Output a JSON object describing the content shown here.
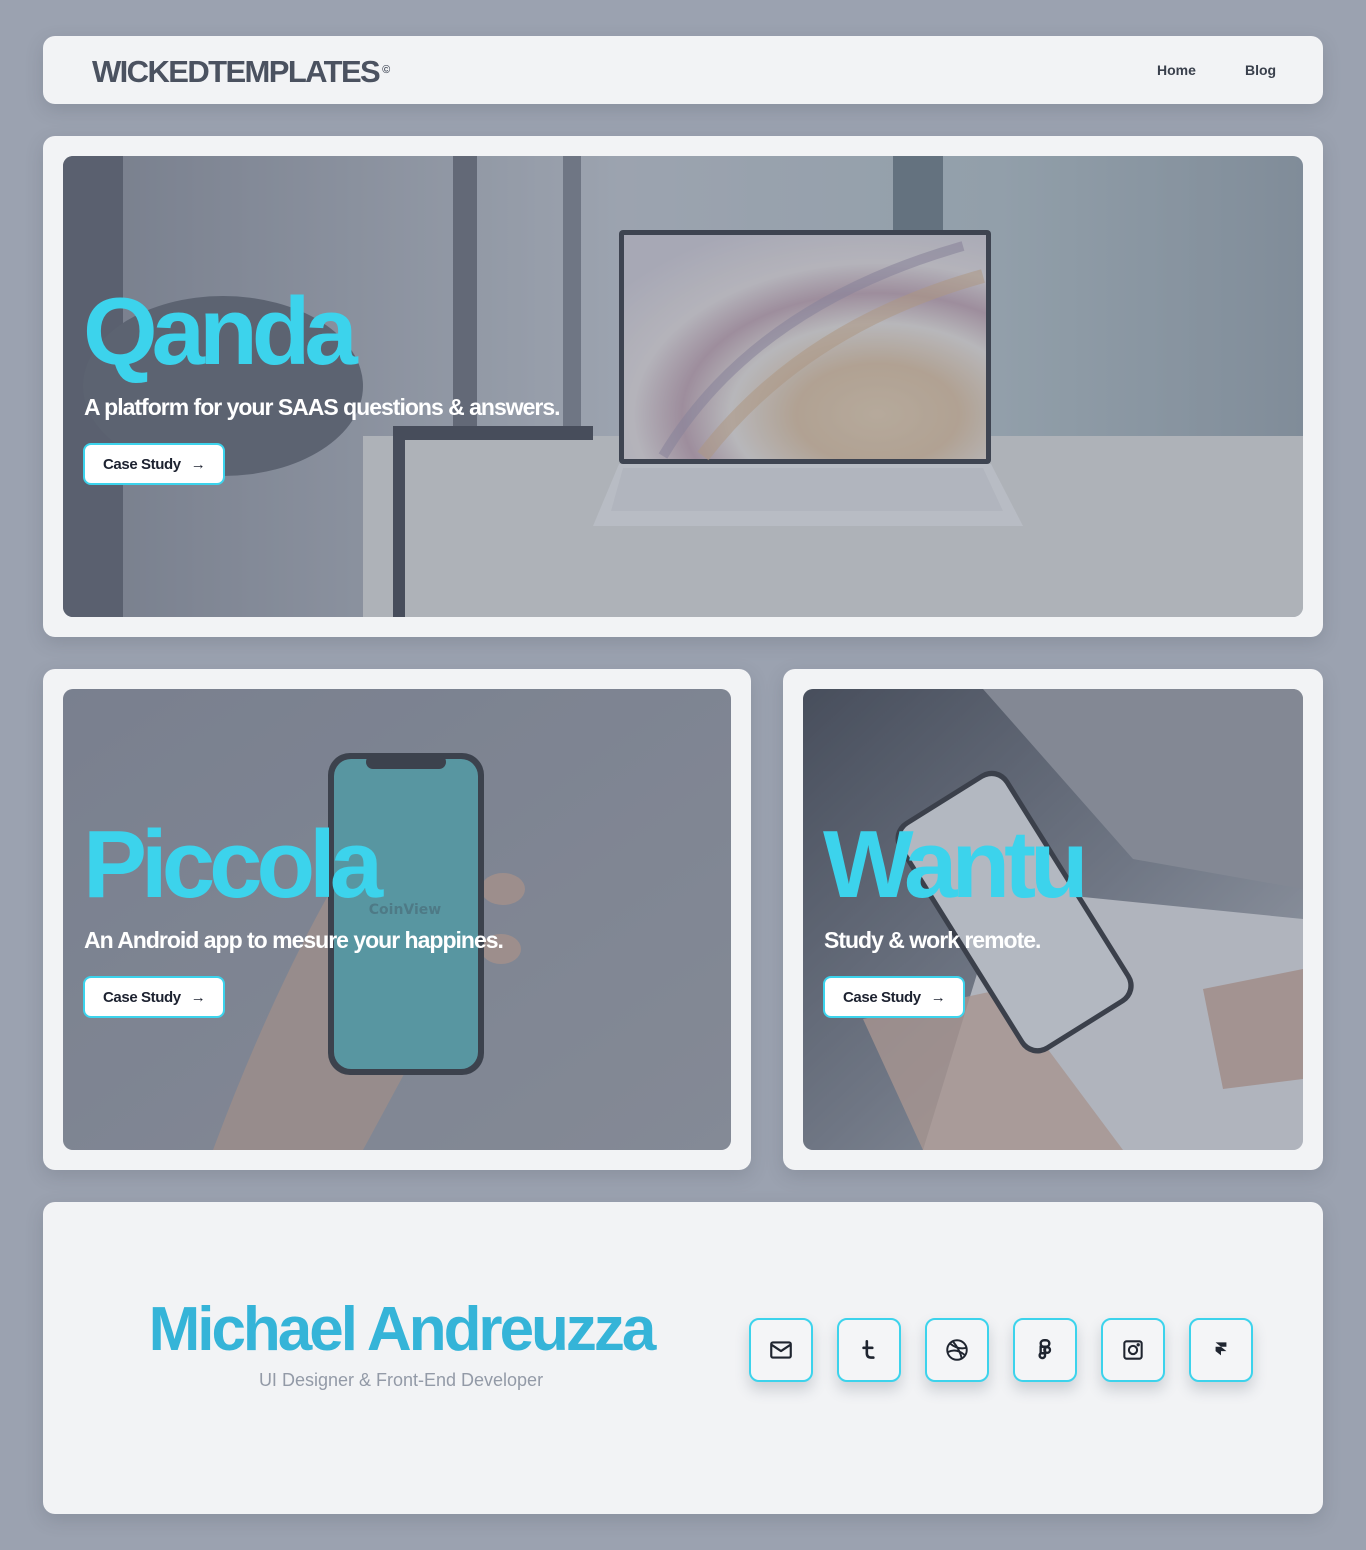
{
  "header": {
    "logo_text": "WICKEDTEMPLATES",
    "logo_mark": "©",
    "nav": [
      {
        "label": "Home"
      },
      {
        "label": "Blog"
      }
    ]
  },
  "projects": [
    {
      "title": "Qanda",
      "description": "A platform for your SAAS questions & answers.",
      "button": "Case Study",
      "image": "laptop-on-desk-photo"
    },
    {
      "title": "Piccola",
      "description": "An Android app to mesure your happines.",
      "button": "Case Study",
      "image": "hand-holding-phone-photo",
      "phone_app_text": "CoinView"
    },
    {
      "title": "Wantu",
      "description": "Study & work remote.",
      "button": "Case Study",
      "image": "phone-and-notebook-photo"
    }
  ],
  "profile": {
    "name": "Michael Andreuzza",
    "role": "UI Designer & Front-End Developer",
    "social": [
      "mail-icon",
      "tumblr-icon",
      "dribbble-icon",
      "figma-icon",
      "instagram-icon",
      "framer-icon"
    ]
  },
  "colors": {
    "background": "#9ba2b0",
    "panel": "#f2f3f5",
    "accent": "#3cd3ec",
    "name": "#35b4d8"
  }
}
